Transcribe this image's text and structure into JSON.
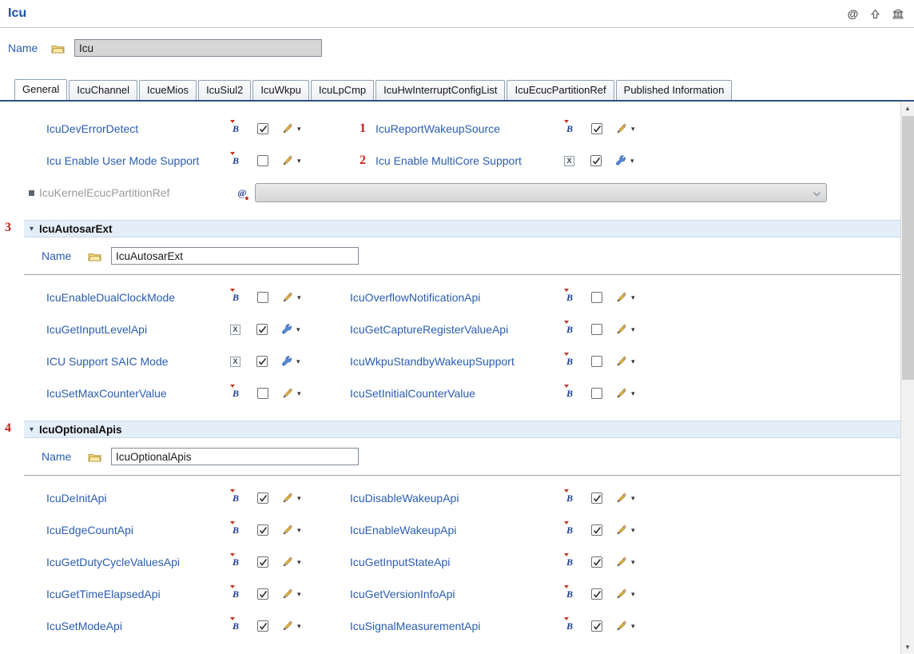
{
  "colors": {
    "title_blue": "#1853a8",
    "label_blue": "#2a5db0",
    "annotation_red": "#cc2020",
    "section_bg": "#e4eef8",
    "section_border": "#c9d8e8",
    "tab_underline": "#2e5282",
    "disabled_text": "#9a9a9a"
  },
  "icons": {
    "at_glyph": "@",
    "default_glyph": "B",
    "config_glyph": "X",
    "caret_glyph": "▾",
    "triangle_glyph": "▾",
    "scroll_up_glyph": "▲",
    "scroll_down_glyph": "▼"
  },
  "header": {
    "title": "Icu"
  },
  "name_field": {
    "label": "Name",
    "value": "Icu"
  },
  "tabs": [
    {
      "label": "General",
      "selected": true
    },
    {
      "label": "IcuChannel",
      "selected": false
    },
    {
      "label": "IcueMios",
      "selected": false
    },
    {
      "label": "IcuSiul2",
      "selected": false
    },
    {
      "label": "IcuWkpu",
      "selected": false
    },
    {
      "label": "IcuLpCmp",
      "selected": false
    },
    {
      "label": "IcuHwInterruptConfigList",
      "selected": false
    },
    {
      "label": "IcuEcucPartitionRef",
      "selected": false
    },
    {
      "label": "Published Information",
      "selected": false
    }
  ],
  "general": {
    "rows": [
      {
        "left": {
          "label": "IcuDevErrorDetect",
          "origin": "default",
          "checked": true,
          "action": "edit"
        },
        "right": {
          "annotation": "1",
          "label": "IcuReportWakeupSource",
          "origin": "default",
          "checked": true,
          "action": "edit"
        }
      },
      {
        "left": {
          "label": "Icu Enable User Mode Support",
          "origin": "default",
          "checked": false,
          "action": "edit"
        },
        "right": {
          "annotation": "2",
          "label": "Icu Enable MultiCore Support",
          "origin": "config",
          "checked": true,
          "action": "system"
        }
      }
    ],
    "ref_row": {
      "label": "IcuKernelEcucPartitionRef",
      "value": "",
      "disabled": true
    }
  },
  "sections": [
    {
      "annotation": "3",
      "title": "IcuAutosarExt",
      "name_field": {
        "label": "Name",
        "value": "IcuAutosarExt"
      },
      "rows": [
        {
          "left": {
            "label": "IcuEnableDualClockMode",
            "origin": "default",
            "checked": false,
            "action": "edit"
          },
          "right": {
            "label": "IcuOverflowNotificationApi",
            "origin": "default",
            "checked": false,
            "action": "edit"
          }
        },
        {
          "left": {
            "label": "IcuGetInputLevelApi",
            "origin": "config",
            "checked": true,
            "action": "system"
          },
          "right": {
            "label": "IcuGetCaptureRegisterValueApi",
            "origin": "default",
            "checked": false,
            "action": "edit"
          }
        },
        {
          "left": {
            "label": "ICU Support SAIC Mode",
            "origin": "config",
            "checked": true,
            "action": "system"
          },
          "right": {
            "label": "IcuWkpuStandbyWakeupSupport",
            "origin": "default",
            "checked": false,
            "action": "edit"
          }
        },
        {
          "left": {
            "label": "IcuSetMaxCounterValue",
            "origin": "default",
            "checked": false,
            "action": "edit"
          },
          "right": {
            "label": "IcuSetInitialCounterValue",
            "origin": "default",
            "checked": false,
            "action": "edit"
          }
        }
      ]
    },
    {
      "annotation": "4",
      "title": "IcuOptionalApis",
      "name_field": {
        "label": "Name",
        "value": "IcuOptionalApis"
      },
      "rows": [
        {
          "left": {
            "label": "IcuDeInitApi",
            "origin": "default",
            "checked": true,
            "action": "edit"
          },
          "right": {
            "label": "IcuDisableWakeupApi",
            "origin": "default",
            "checked": true,
            "action": "edit"
          }
        },
        {
          "left": {
            "label": "IcuEdgeCountApi",
            "origin": "default",
            "checked": true,
            "action": "edit"
          },
          "right": {
            "label": "IcuEnableWakeupApi",
            "origin": "default",
            "checked": true,
            "action": "edit"
          }
        },
        {
          "left": {
            "label": "IcuGetDutyCycleValuesApi",
            "origin": "default",
            "checked": true,
            "action": "edit"
          },
          "right": {
            "label": "IcuGetInputStateApi",
            "origin": "default",
            "checked": true,
            "action": "edit"
          }
        },
        {
          "left": {
            "label": "IcuGetTimeElapsedApi",
            "origin": "default",
            "checked": true,
            "action": "edit"
          },
          "right": {
            "label": "IcuGetVersionInfoApi",
            "origin": "default",
            "checked": true,
            "action": "edit"
          }
        },
        {
          "left": {
            "label": "IcuSetModeApi",
            "origin": "default",
            "checked": true,
            "action": "edit"
          },
          "right": {
            "label": "IcuSignalMeasurementApi",
            "origin": "default",
            "checked": true,
            "action": "edit"
          }
        }
      ]
    }
  ]
}
